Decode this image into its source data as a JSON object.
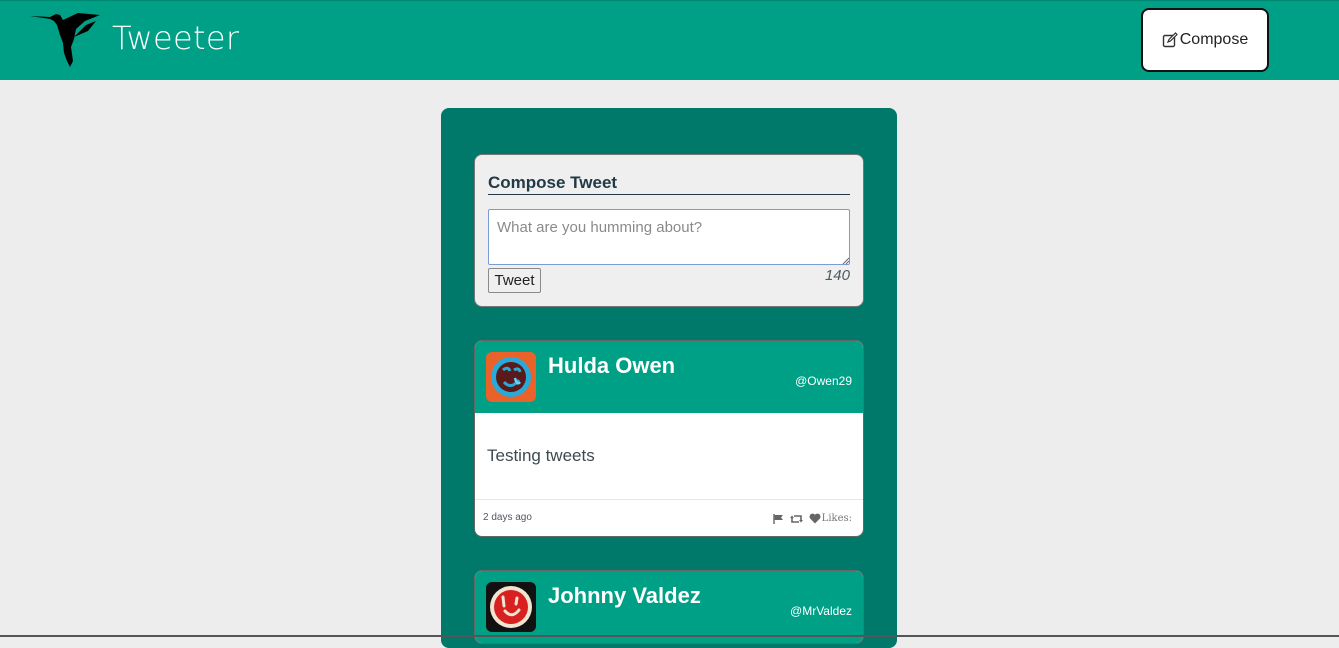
{
  "navbar": {
    "brand": "Tweeter",
    "compose_label": "Compose",
    "bg_color": "#00a087"
  },
  "compose": {
    "title": "Compose Tweet",
    "placeholder": "What are you humming about?",
    "submit_label": "Tweet",
    "counter": "140"
  },
  "tweets": [
    {
      "name": "Hulda Owen",
      "handle": "@Owen29",
      "text": "Testing tweets",
      "time": "2 days ago",
      "likes_label": "Likes:"
    },
    {
      "name": "Johnny Valdez",
      "handle": "@MrValdez"
    }
  ],
  "icons": [
    "hummingbird-logo",
    "pencil-square-icon",
    "flag-icon",
    "retweet-icon",
    "heart-icon"
  ]
}
